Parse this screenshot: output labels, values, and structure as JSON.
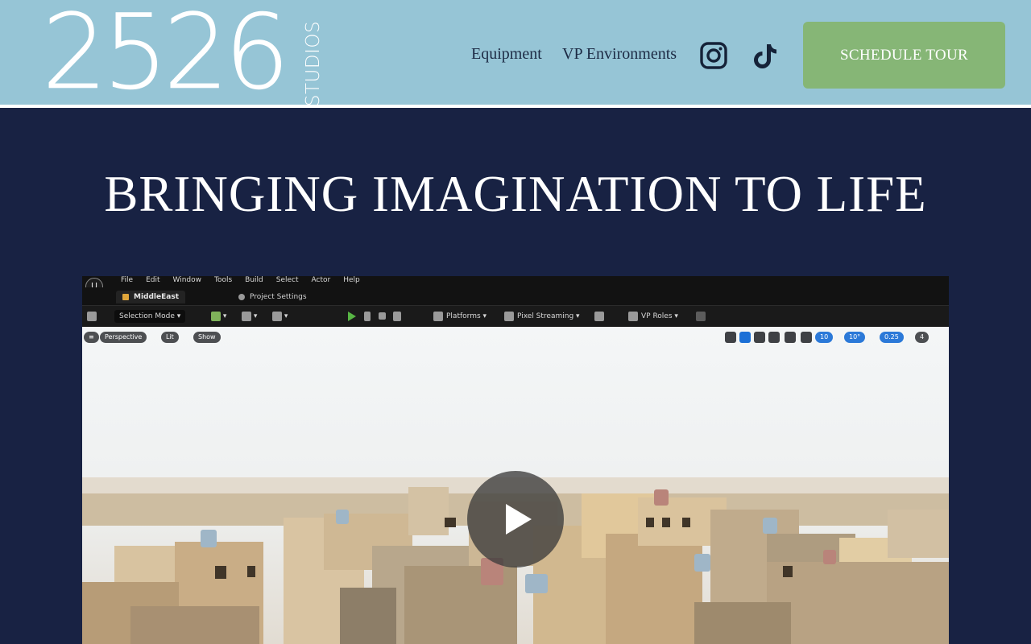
{
  "header": {
    "logo_digits": "2526",
    "logo_sub": "STUDIOS",
    "nav": [
      "Equipment",
      "VP Environments"
    ],
    "social": [
      "instagram-icon",
      "tiktok-icon"
    ],
    "cta_label": "SCHEDULE TOUR"
  },
  "hero": {
    "title": "BRINGING IMAGINATION TO LIFE"
  },
  "video": {
    "editor": {
      "logo": "U",
      "menu": [
        "File",
        "Edit",
        "Window",
        "Tools",
        "Build",
        "Select",
        "Actor",
        "Help"
      ],
      "tabs": [
        "MiddleEast",
        "Project Settings"
      ],
      "toolbar": {
        "mode": "Selection Mode",
        "platforms": "Platforms",
        "streaming": "Pixel Streaming",
        "roles": "VP Roles"
      },
      "viewport": {
        "perspective": "Perspective",
        "lit": "Lit",
        "show": "Show",
        "grid_snap": "10",
        "rotation_snap": "10°",
        "scale_snap": "0.25",
        "camera_speed": "4"
      }
    },
    "play_icon": "play-icon"
  },
  "colors": {
    "header_bg": "#96c5d6",
    "page_bg": "#182243",
    "cta_bg": "#86b676",
    "nav_text": "#1c2a44"
  }
}
